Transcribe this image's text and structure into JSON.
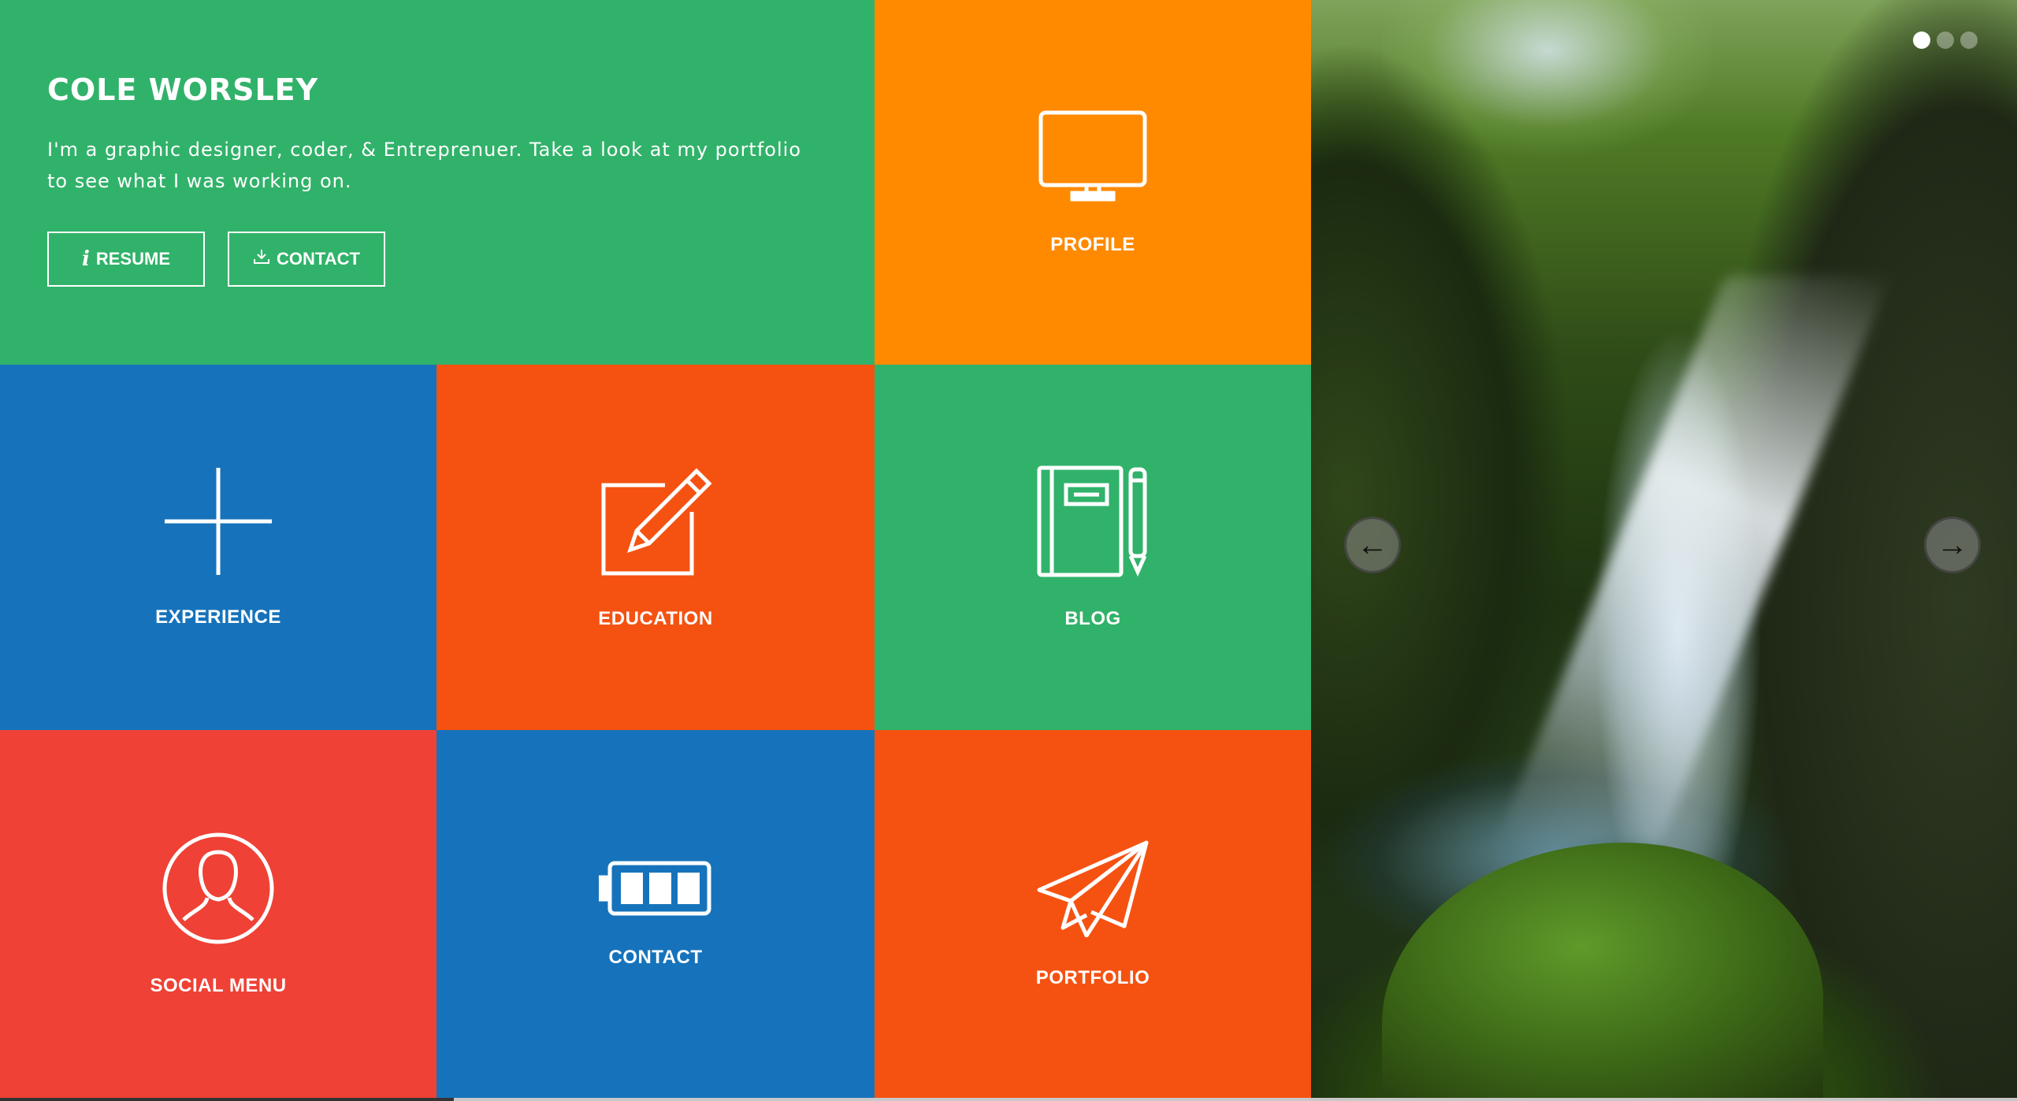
{
  "colors": {
    "green": "#31b26a",
    "orange": "#ff8a00",
    "blue": "#1673bb",
    "red_orange": "#f55212",
    "red": "#ef4135"
  },
  "intro": {
    "name": "COLE WORSLEY",
    "bio": "I'm a graphic designer, coder, & Entreprenuer. Take a look at my portfolio to see what I was working on.",
    "resume_label": "RESUME",
    "resume_icon": "i",
    "contact_label": "CONTACT"
  },
  "tiles": {
    "profile": {
      "label": "PROFILE",
      "icon": "monitor-icon"
    },
    "experience": {
      "label": "EXPERIENCE",
      "icon": "plus-icon"
    },
    "education": {
      "label": "EDUCATION",
      "icon": "pencil-square-icon"
    },
    "blog": {
      "label": "BLOG",
      "icon": "notebook-icon"
    },
    "social": {
      "label": "SOCIAL MENU",
      "icon": "person-icon"
    },
    "contact": {
      "label": "CONTACT",
      "icon": "battery-icon"
    },
    "portfolio": {
      "label": "PORTFOLIO",
      "icon": "paper-plane-icon"
    }
  },
  "slider": {
    "prev_glyph": "←",
    "next_glyph": "→",
    "image": "waterfall-forest-photo",
    "slide_count": 3,
    "active_slide": 1
  }
}
